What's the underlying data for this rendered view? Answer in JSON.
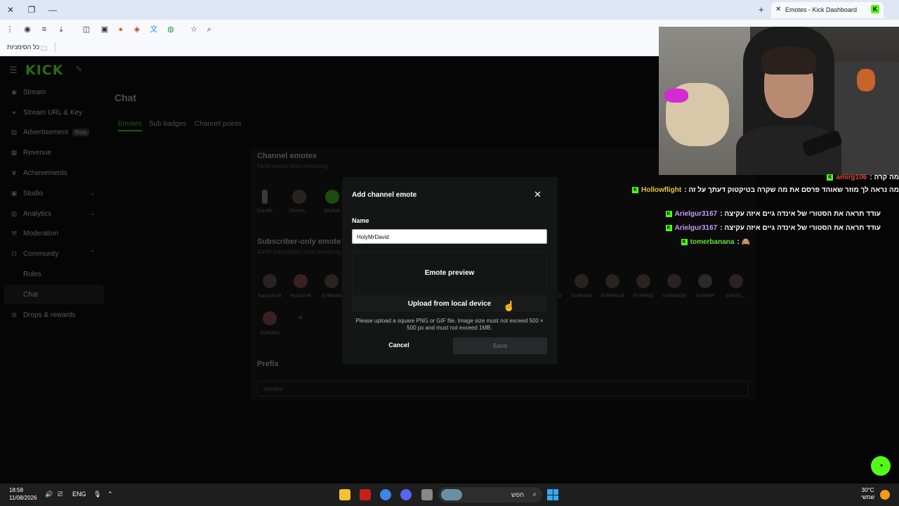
{
  "browser": {
    "tab_title": "Emotes - Kick Dashboard",
    "tab_icon": "K",
    "bookmarks_label": "כל הסימניות"
  },
  "sidebar": {
    "logo": "KICK",
    "items": [
      {
        "label": "Stream"
      },
      {
        "label": "Stream URL & Key"
      },
      {
        "label": "Advertisement",
        "badge": "Beta"
      },
      {
        "label": "Revenue"
      },
      {
        "label": "Achievements"
      },
      {
        "label": "Studio"
      },
      {
        "label": "Analytics"
      },
      {
        "label": "Moderation"
      },
      {
        "label": "Community"
      },
      {
        "label": "Roles"
      },
      {
        "label": "Chat"
      },
      {
        "label": "Drops & rewards"
      }
    ]
  },
  "main": {
    "title": "Chat",
    "tabs": [
      "Emotes",
      "Sub badges",
      "Channel points"
    ],
    "channel_emotes": {
      "title": "Channel emotes",
      "subtitle": "54/60 emote slots remaining",
      "items": [
        "Candle",
        "Cheers...",
        "GUAVA"
      ]
    },
    "subscriber_emotes": {
      "title": "Subscriber-only emote",
      "subtitle": "43/60 subscribers slots remaining",
      "items_left": [
        "NarcoSVR",
        "PussSVR",
        "SVRBAN"
      ],
      "items_right": [
        "D",
        "SVRMAH",
        "SVRPALM",
        "SVRPOG",
        "SVRRAGE",
        "SVRRIP",
        "SVRSC..."
      ],
      "items_row2": [
        "SVRWIN"
      ],
      "add_label": "+"
    },
    "prefix": {
      "title": "Prefix",
      "value": "odedsvr"
    }
  },
  "modal": {
    "title": "Add channel emote",
    "name_label": "Name",
    "name_value": "HolyMrDavid",
    "preview_label": "Emote preview",
    "upload_label": "Upload from local device",
    "hint": "Please upload a square PNG or GIF file. Image size must not exceed 500 × 500 px and must not exceed 1MB.",
    "cancel_label": "Cancel",
    "save_label": "Save"
  },
  "chat_overlay": [
    {
      "user": "amirg106",
      "message": ": מה קרה",
      "color": "#e04b3a"
    },
    {
      "user": "Hollowflight",
      "message": ": מה נראה לך מוזר שאוהד פרסם את מה שקרה בטיקטוק דעתך על זה",
      "color": "#e8c23a"
    },
    {
      "user": "Arielgur3167",
      "message": ": עודד תראה את הסטורי של אינדה גיים איזה עקיצה",
      "color": "#c59cf0"
    },
    {
      "user": "Arielgur3167",
      "message": ": עודד תראה את הסטורי של אינדה גיים איזה עקיצה",
      "color": "#c59cf0"
    },
    {
      "user": "tomerbanana",
      "message": ": 🙈",
      "color": "#62e03a"
    }
  ],
  "taskbar": {
    "time": "18:58",
    "date": "11/08/2026",
    "lang": "ENG",
    "search_placeholder": "חפש",
    "temperature": "30°C",
    "weather": "שמשי"
  },
  "colors": {
    "kick_green": "#53fc18",
    "modal_bg": "#141515"
  }
}
